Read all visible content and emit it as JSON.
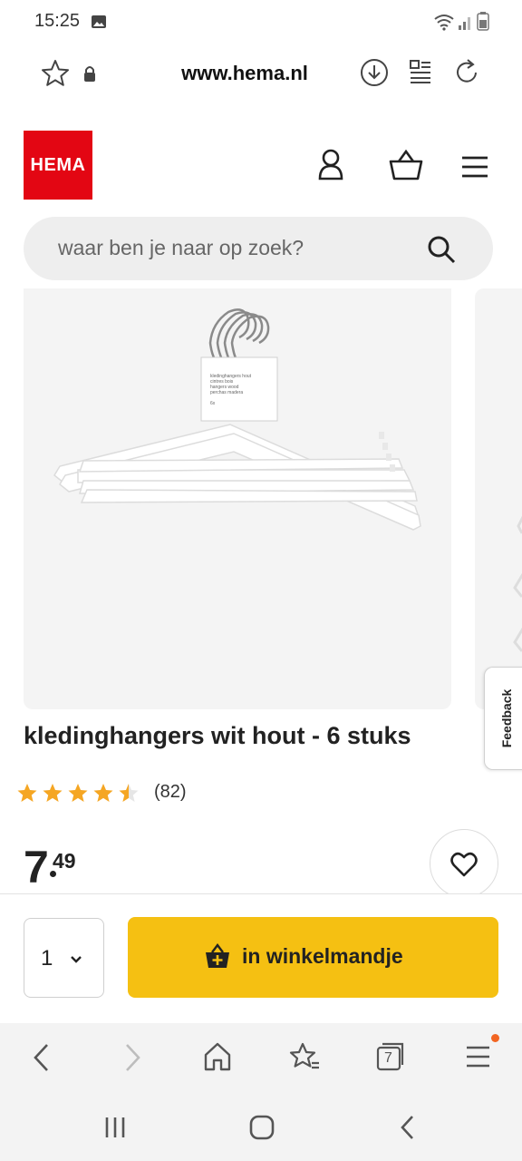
{
  "status_bar": {
    "time": "15:25"
  },
  "browser": {
    "url": "www.hema.nl",
    "tab_count": "7"
  },
  "header": {
    "logo_text": "HEMA",
    "search_placeholder": "waar ben je naar op zoek?"
  },
  "product": {
    "title": "kledinghangers wit hout - 6 stuks",
    "rating": 4.5,
    "rating_max": 5,
    "review_count": "(82)",
    "price_int": "7",
    "price_dec": "49",
    "package_label": [
      "kledinghangers hout",
      "cintres bois",
      "hangers wood",
      "perchas madera",
      "6x"
    ]
  },
  "feedback": {
    "label": "Feedback"
  },
  "cart": {
    "quantity": "1",
    "add_label": "in winkelmandje"
  },
  "colors": {
    "brand_red": "#e30613",
    "cta_yellow": "#f5c012",
    "star": "#f5a623",
    "notification_dot": "#f26522"
  }
}
